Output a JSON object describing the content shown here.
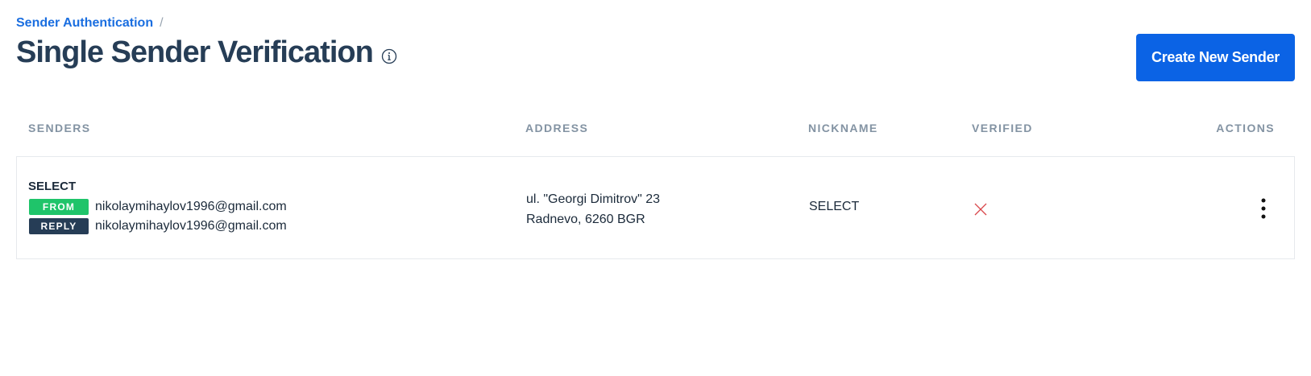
{
  "breadcrumb": {
    "parent": "Sender Authentication",
    "separator": "/"
  },
  "page": {
    "title": "Single Sender Verification",
    "info_icon": "info-icon"
  },
  "toolbar": {
    "create_label": "Create New Sender"
  },
  "table": {
    "columns": [
      "SENDERS",
      "ADDRESS",
      "NICKNAME",
      "VERIFIED",
      "ACTIONS"
    ],
    "rows": [
      {
        "sender_name": "SELECT",
        "from_badge": "FROM",
        "from_email": "nikolaymihaylov1996@gmail.com",
        "reply_badge": "REPLY",
        "reply_email": "nikolaymihaylov1996@gmail.com",
        "address_line1": "ul. \"Georgi Dimitrov\" 23",
        "address_line2": "Radnevo, 6260 BGR",
        "nickname": "SELECT",
        "verified": false,
        "verified_icon": "x-icon",
        "actions_icon": "more-vertical-icon"
      }
    ]
  },
  "colors": {
    "primary": "#0b63e5",
    "link": "#1a6ee0",
    "title": "#263d56",
    "badge_from": "#1fc46a",
    "badge_reply": "#263d56",
    "unverified": "#d9474b",
    "header_text": "#8393a3"
  }
}
